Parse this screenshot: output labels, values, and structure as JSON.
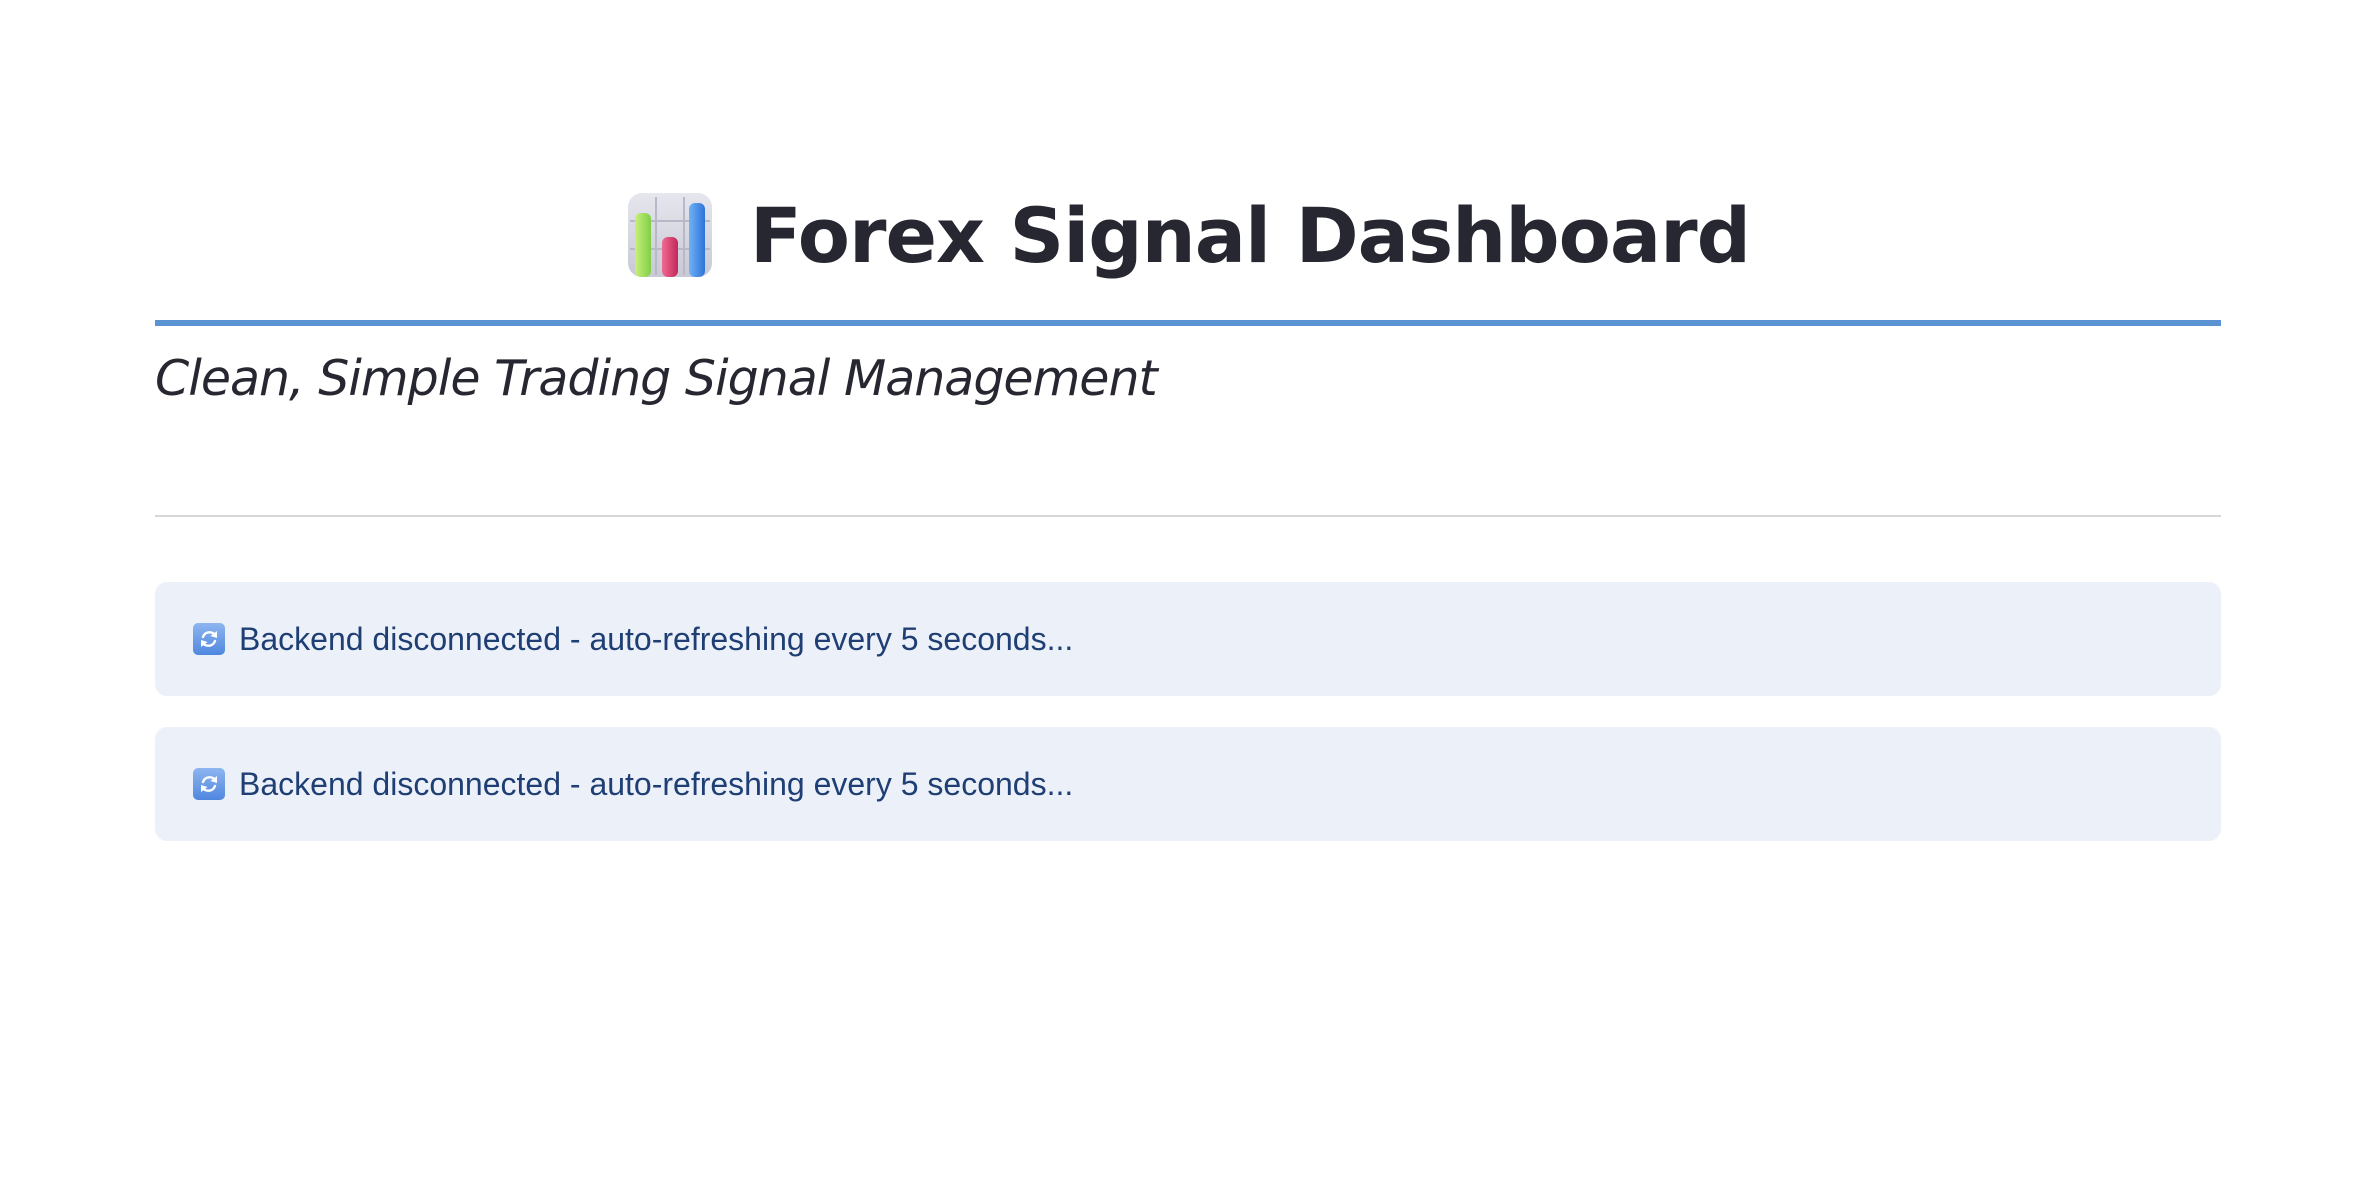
{
  "header": {
    "icon": "bar-chart-icon",
    "title": "Forex Signal Dashboard",
    "subtitle": "Clean, Simple Trading Signal Management"
  },
  "alerts": [
    {
      "icon": "refresh-icon",
      "message": "Backend disconnected - auto-refreshing every 5 seconds..."
    },
    {
      "icon": "refresh-icon",
      "message": "Backend disconnected - auto-refreshing every 5 seconds..."
    }
  ],
  "colors": {
    "accent_rule": "#5b93d2",
    "alert_background": "#ecf1f9",
    "alert_text": "#1f3f74",
    "heading_text": "#262730"
  }
}
